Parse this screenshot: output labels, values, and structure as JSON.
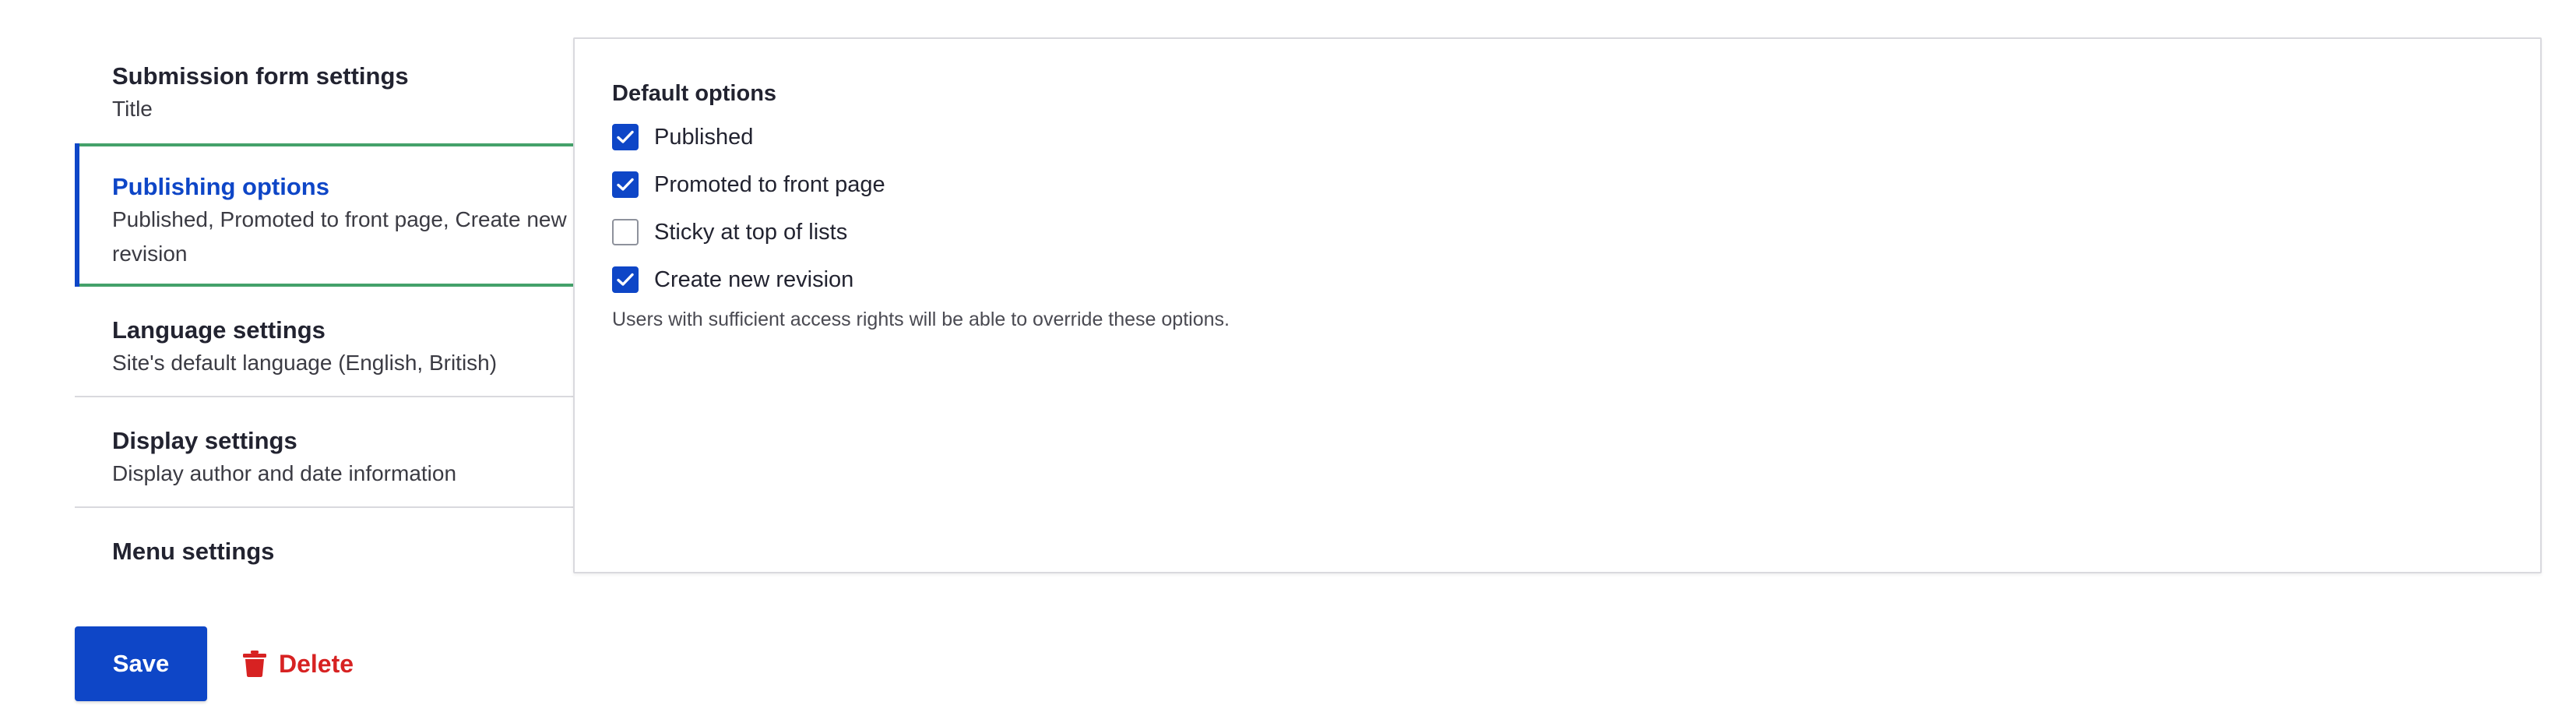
{
  "colors": {
    "accent_blue": "#0e46c7",
    "active_tab_border": "#44a16a",
    "danger_red": "#d72222"
  },
  "vertical_tabs": [
    {
      "title": "Submission form settings",
      "summary": "Title"
    },
    {
      "title": "Publishing options",
      "summary": "Published, Promoted to front page, Create new revision",
      "active": true
    },
    {
      "title": "Language settings",
      "summary": "Site's default language (English, British)"
    },
    {
      "title": "Display settings",
      "summary": "Display author and date information"
    },
    {
      "title": "Menu settings",
      "summary": ""
    }
  ],
  "pane": {
    "legend": "Default options",
    "options": [
      {
        "label": "Published",
        "checked": true
      },
      {
        "label": "Promoted to front page",
        "checked": true
      },
      {
        "label": "Sticky at top of lists",
        "checked": false
      },
      {
        "label": "Create new revision",
        "checked": true
      }
    ],
    "description": "Users with sufficient access rights will be able to override these options."
  },
  "actions": {
    "save_label": "Save",
    "delete_label": "Delete",
    "delete_icon": "trash-icon",
    "check_icon": "checkmark-icon"
  }
}
